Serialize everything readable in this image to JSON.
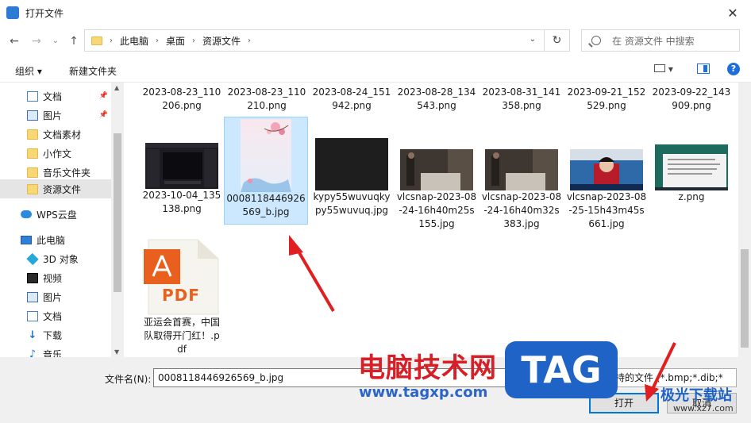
{
  "window": {
    "title": "打开文件",
    "close_glyph": "✕"
  },
  "nav": {
    "back": "←",
    "forward": "→",
    "recent": "⌄",
    "up": "↑",
    "breadcrumb": [
      "此电脑",
      "桌面",
      "资源文件"
    ],
    "sep": "›",
    "refresh": "↻",
    "search_placeholder": "在 资源文件 中搜索"
  },
  "toolbar": {
    "organize": "组织 ▾",
    "new_folder": "新建文件夹"
  },
  "sidebar": {
    "items": [
      {
        "label": "文档",
        "icon": "document-icon",
        "pinned": true
      },
      {
        "label": "图片",
        "icon": "picture-icon",
        "pinned": true
      },
      {
        "label": "文档素材",
        "icon": "folder-icon"
      },
      {
        "label": "小作文",
        "icon": "folder-icon"
      },
      {
        "label": "音乐文件夹",
        "icon": "folder-icon"
      },
      {
        "label": "资源文件",
        "icon": "folder-icon",
        "selected": true
      },
      {
        "label": "WPS云盘",
        "icon": "cloud-icon"
      },
      {
        "label": "此电脑",
        "icon": "computer-icon"
      },
      {
        "label": "3D 对象",
        "icon": "3d-objects-icon"
      },
      {
        "label": "视频",
        "icon": "video-icon"
      },
      {
        "label": "图片",
        "icon": "picture-icon"
      },
      {
        "label": "文档",
        "icon": "document-icon"
      },
      {
        "label": "下载",
        "icon": "download-icon"
      },
      {
        "label": "音乐",
        "icon": "music-icon"
      }
    ]
  },
  "files": {
    "row1": [
      "2023-08-23_110206.png",
      "2023-08-23_110210.png",
      "2023-08-24_151942.png",
      "2023-08-28_134543.png",
      "2023-08-31_141358.png",
      "2023-09-21_152529.png",
      "2023-09-22_143909.png"
    ],
    "row2": [
      "2023-10-04_135138.png",
      "0008118446926569_b.jpg",
      "kypy55wuvuqkypy55wuvuq.jpg",
      "vlcsnap-2023-08-24-16h40m25s155.jpg",
      "vlcsnap-2023-08-24-16h40m32s383.jpg",
      "vlcsnap-2023-08-25-15h43m45s661.jpg",
      "z.png"
    ],
    "row3": [
      "亚运会首赛，中国队取得开门红！.pdf"
    ],
    "pdf_label": "PDF"
  },
  "bottom": {
    "filename_label": "文件名(N):",
    "filename_value": "0008118446926569_b.jpg",
    "filetype_value": "所有支持的文件 (*.bmp;*.dib;*",
    "open_label": "打开",
    "cancel_label": "取消"
  },
  "watermark": {
    "cn": "电脑技术网",
    "url": "www.tagxp.com",
    "tag": "TAG",
    "jg": "极光下载站",
    "xz": "www.xz7.com"
  },
  "colors": {
    "accent": "#0078d7",
    "selection": "#cce8ff",
    "arrow": "#e02020"
  }
}
